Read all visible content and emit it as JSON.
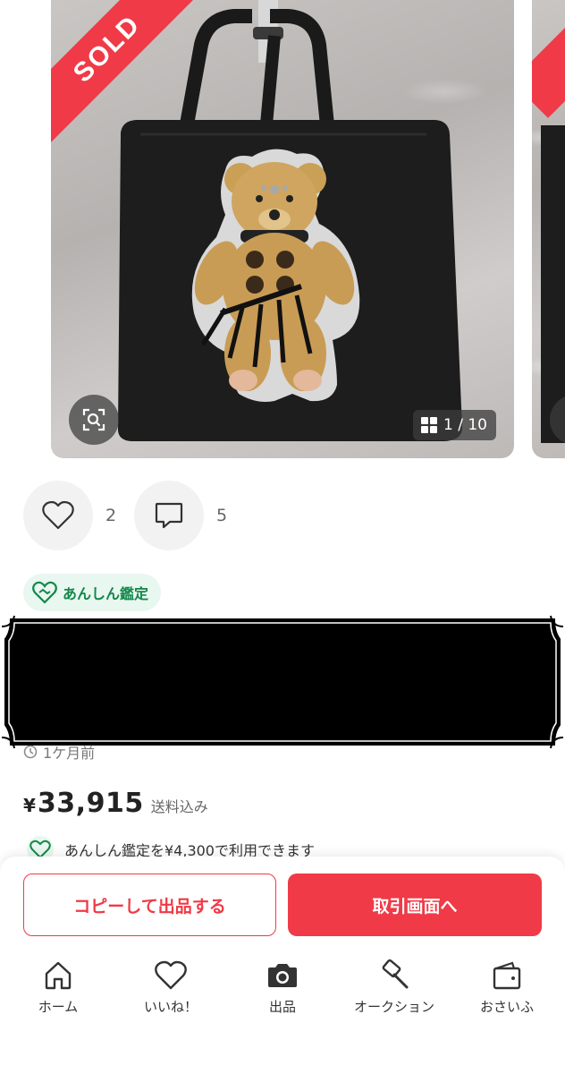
{
  "gallery": {
    "sold_label": "SOLD",
    "counter": "1 / 10"
  },
  "reactions": {
    "likes": "2",
    "comments": "5"
  },
  "anshin": {
    "badge_label": "あんしん鑑定",
    "note": "あんしん鑑定を¥4,300で利用できます"
  },
  "listing": {
    "posted": "1ケ月前",
    "currency": "¥",
    "price": "33,915",
    "shipping": "送料込み"
  },
  "actions": {
    "copy_label": "コピーして出品する",
    "trade_label": "取引画面へ"
  },
  "tabs": [
    {
      "label": "ホーム",
      "icon": "home-icon"
    },
    {
      "label": "いいね！",
      "icon": "heart-icon"
    },
    {
      "label": "出品",
      "icon": "camera-icon"
    },
    {
      "label": "オークション",
      "icon": "gavel-icon"
    },
    {
      "label": "おさいふ",
      "icon": "wallet-icon"
    }
  ],
  "colors": {
    "accent": "#f03a47",
    "anshin_green": "#14864b",
    "anshin_bg": "#e8f7ef"
  }
}
